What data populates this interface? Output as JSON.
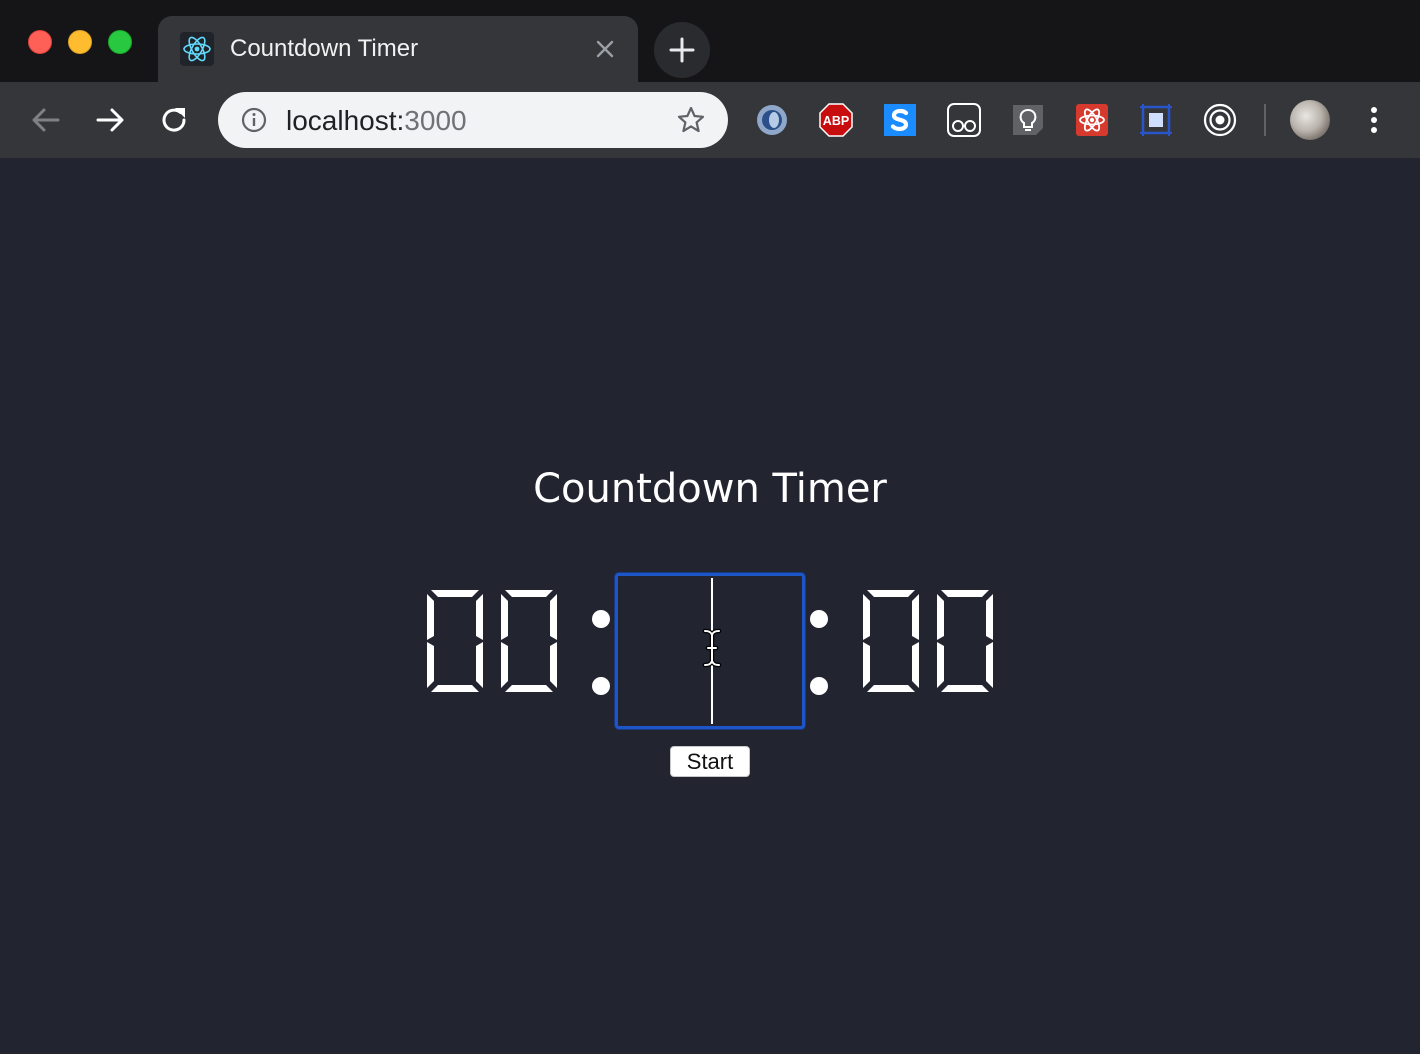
{
  "tab": {
    "title": "Countdown Timer",
    "favicon": "react-icon"
  },
  "omnibox": {
    "host": "localhost:",
    "port": "3000"
  },
  "extensions": [
    "blue-drop-extension-icon",
    "adblock-plus-extension-icon",
    "s-extension-icon",
    "glasses-extension-icon",
    "lightbulb-extension-icon",
    "react-devtools-extension-icon",
    "square-extension-icon",
    "target-extension-icon"
  ],
  "timer": {
    "title": "Countdown Timer",
    "hours": "00",
    "minutes_input_value": "",
    "seconds": "00",
    "start_label": "Start"
  },
  "colors": {
    "page_bg": "#222530",
    "focus_border": "#1e56c7",
    "digit_color": "#ffffff"
  }
}
